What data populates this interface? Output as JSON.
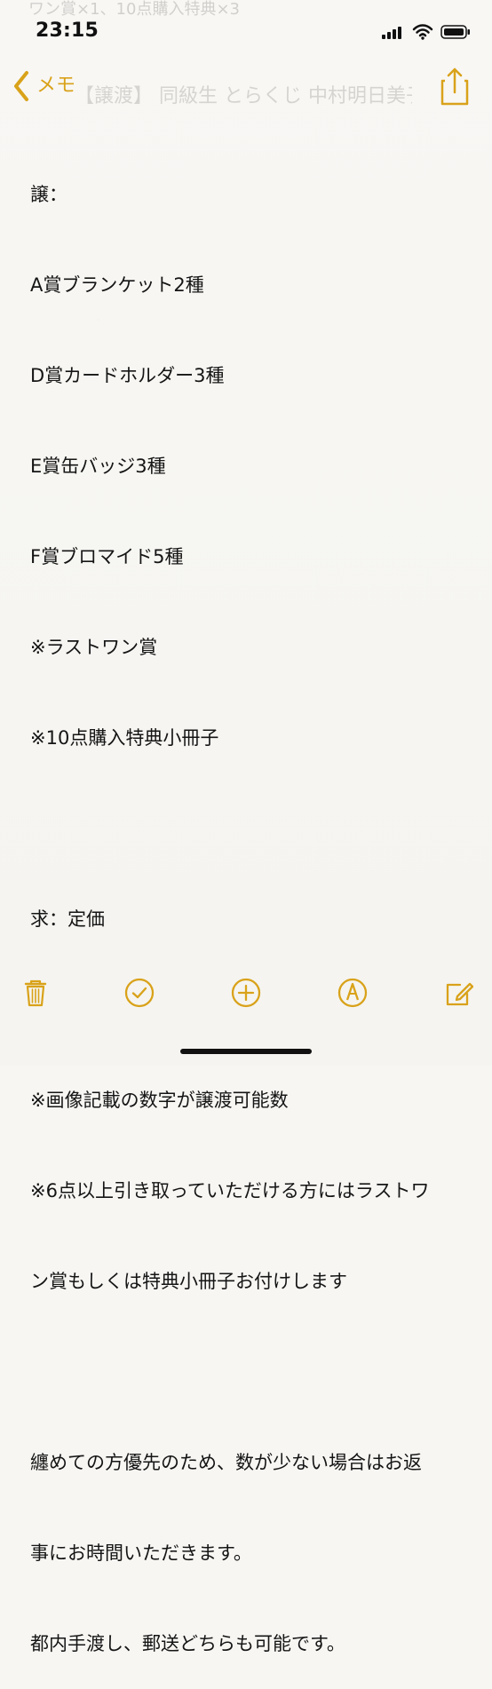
{
  "status_bar": {
    "time": "23:15",
    "background_text": "ワン賞×1、10点購入特典×3"
  },
  "nav": {
    "back_label": "メモ",
    "background_title": "【譲渡】 同級生 とらくじ 中村明日美子",
    "share_icon": "share-icon"
  },
  "note": {
    "lines": [
      "譲：",
      "A賞ブランケット2種",
      "D賞カードホルダー3種",
      "E賞缶バッジ3種",
      "F賞ブロマイド5種",
      "※ラストワン賞",
      "※10点購入特典小冊子",
      "",
      "求：定価",
      "",
      "※画像記載の数字が譲渡可能数",
      "※6点以上引き取っていただける方にはラストワ",
      "ン賞もしくは特典小冊子お付けします",
      "",
      "纏めての方優先のため、数が少ない場合はお返",
      "事にお時間いただきます。",
      "都内手渡し、郵送どちらも可能です。"
    ]
  },
  "toolbar": {
    "icons": [
      "trash-icon",
      "checklist-icon",
      "add-icon",
      "draw-icon",
      "compose-icon"
    ]
  },
  "colors": {
    "accent": "#d9a21a",
    "background": "#f7f6f3",
    "text": "#151515"
  }
}
